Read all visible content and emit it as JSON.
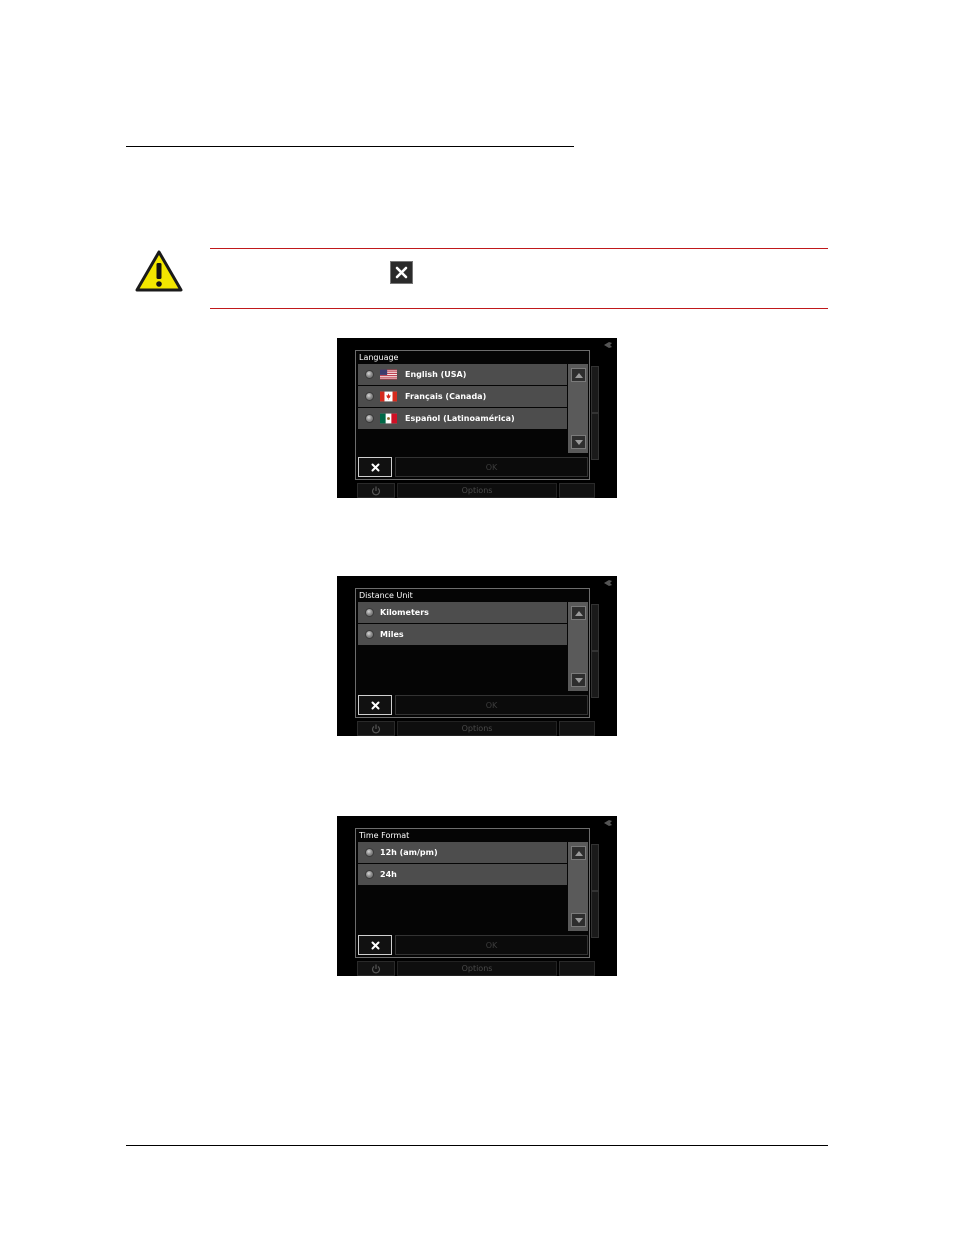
{
  "screens": [
    {
      "title": "Language",
      "items": [
        {
          "label": "English (USA)",
          "flag": "us-flag-icon"
        },
        {
          "label": "Français (Canada)",
          "flag": "canada-flag-icon"
        },
        {
          "label": "Español (Latinoamérica)",
          "flag": "mexico-flag-icon"
        }
      ],
      "ok_label": "OK",
      "options_label": "Options"
    },
    {
      "title": "Distance Unit",
      "items": [
        {
          "label": "Kilometers"
        },
        {
          "label": "Miles"
        }
      ],
      "ok_label": "OK",
      "options_label": "Options"
    },
    {
      "title": "Time Format",
      "items": [
        {
          "label": "12h (am/pm)"
        },
        {
          "label": "24h"
        }
      ],
      "ok_label": "OK",
      "options_label": "Options"
    }
  ],
  "colors": {
    "note_rule": "#c0191b",
    "row_bg": "#4d4d4d",
    "warning_yellow": "#f2e600"
  }
}
